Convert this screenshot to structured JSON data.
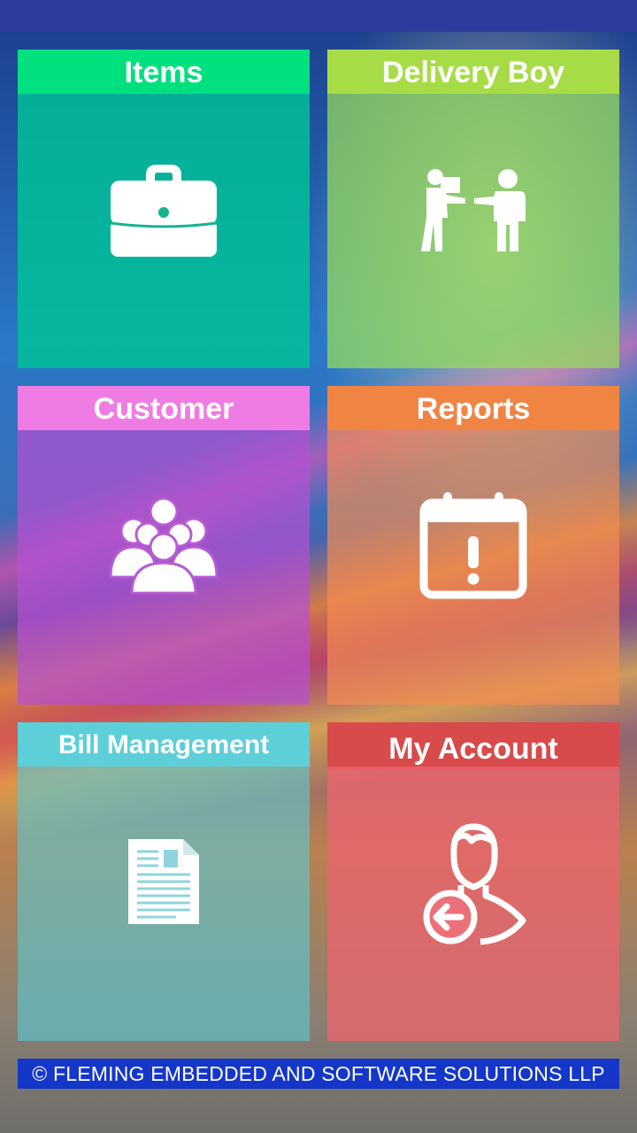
{
  "tiles": {
    "items": {
      "label": "Items",
      "icon": "briefcase-icon"
    },
    "delivery_boy": {
      "label": "Delivery Boy",
      "icon": "delivery-boy-icon"
    },
    "customer": {
      "label": "Customer",
      "icon": "group-icon"
    },
    "reports": {
      "label": "Reports",
      "icon": "calendar-alert-icon"
    },
    "bill_management": {
      "label": "Bill Management",
      "icon": "document-icon"
    },
    "my_account": {
      "label": "My Account",
      "icon": "user-logout-icon"
    }
  },
  "footer": {
    "text": "© FLEMING EMBEDDED AND SOFTWARE SOLUTIONS LLP"
  },
  "colors": {
    "status_bar": "#2e3b9c",
    "items": "#00e07f",
    "delivery_boy": "#a8dc47",
    "customer": "#ef7ce3",
    "reports": "#f08443",
    "bill_management": "#5ccfd8",
    "my_account": "#d94a4a",
    "footer": "#1436c9"
  }
}
